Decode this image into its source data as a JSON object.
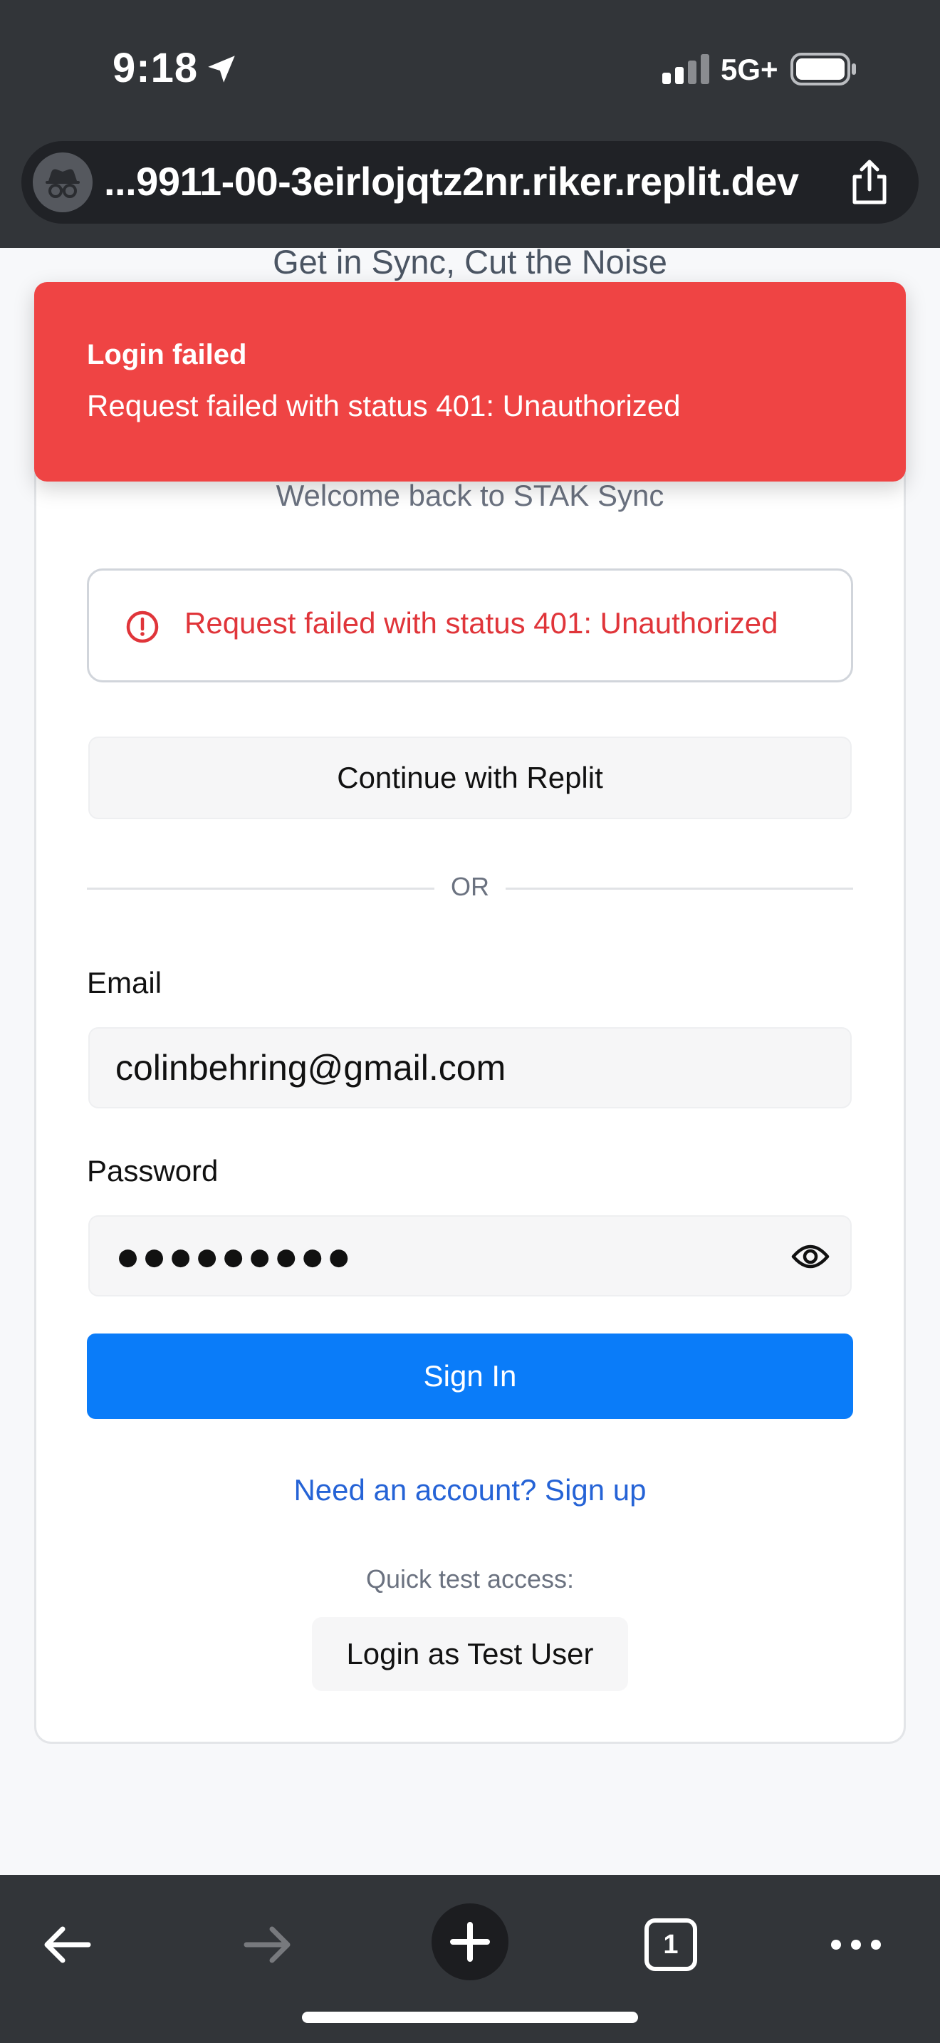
{
  "status_bar": {
    "time": "9:18",
    "network": "5G+"
  },
  "browser": {
    "url": "...9911-00-3eirlojqtz2nr.riker.replit.dev",
    "tab_count": "1"
  },
  "page": {
    "tagline": "Get in Sync, Cut the Noise",
    "welcome": "Welcome back to STAK Sync",
    "error_alert": "Request failed with status 401: Unauthorized",
    "replit_button": "Continue with Replit",
    "divider": "OR",
    "email_label": "Email",
    "email_value": "colinbehring@gmail.com",
    "password_label": "Password",
    "password_mask": "●●●●●●●●●",
    "signin_button": "Sign In",
    "signup_link": "Need an account? Sign up",
    "quick_test_label": "Quick test access:",
    "test_user_button": "Login as Test User"
  },
  "toast": {
    "title": "Login failed",
    "message": "Request failed with status 401: Unauthorized"
  },
  "colors": {
    "primary": "#0a7cf9",
    "error": "#ef4444",
    "error_text": "#e0353a",
    "link": "#2563d6",
    "chrome": "#323539"
  },
  "icons": {
    "status_arrow": "location-arrow-icon",
    "signal": "cellular-signal-icon",
    "battery": "battery-icon",
    "incognito": "incognito-icon",
    "share": "share-icon",
    "error": "alert-circle-icon",
    "eye": "eye-icon",
    "back": "back-arrow-icon",
    "forward": "forward-arrow-icon",
    "new_tab": "plus-icon",
    "tabs": "tab-switcher-icon",
    "more": "more-icon"
  }
}
